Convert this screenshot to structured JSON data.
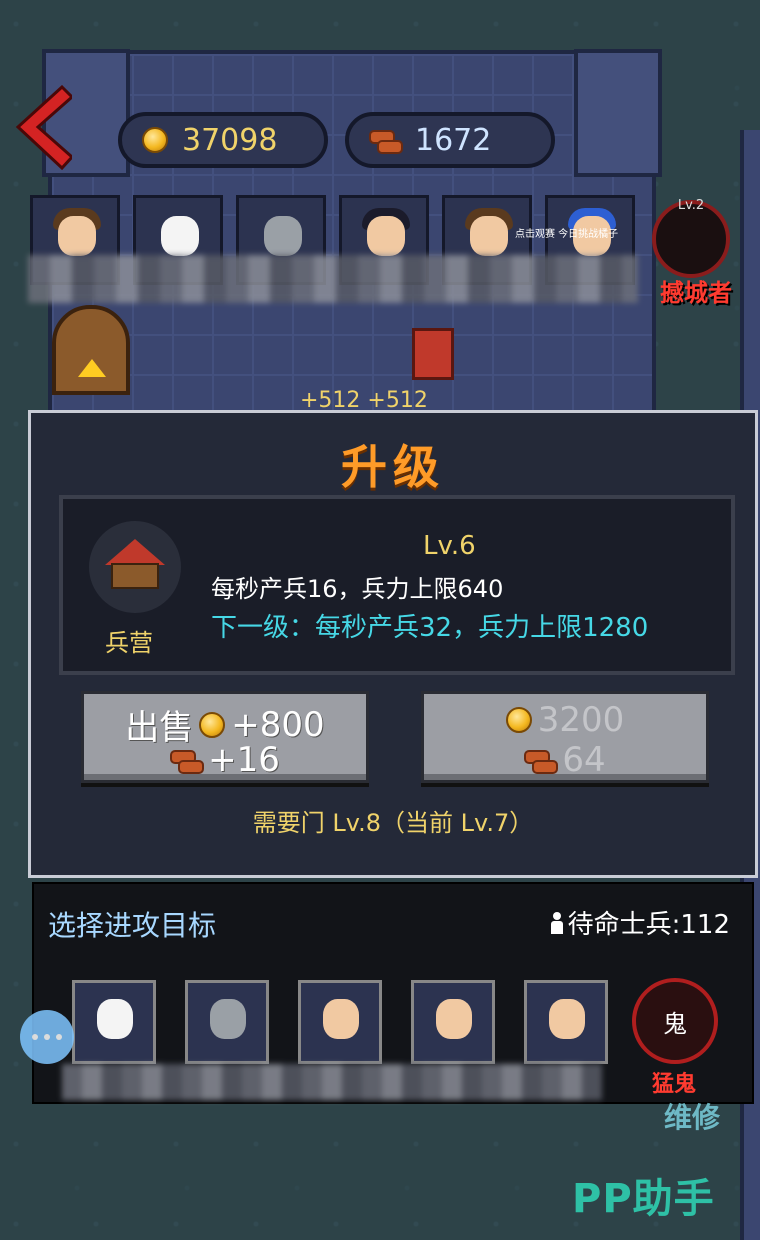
{
  "resources": {
    "gold": "37098",
    "wood": "1672"
  },
  "top_avatars": [
    "avatar-1",
    "avatar-2",
    "avatar-3",
    "avatar-4",
    "avatar-5",
    "avatar-6"
  ],
  "avatar_small_text": "点击观赛 今日挑战橘子",
  "enemy": {
    "level": "Lv.2",
    "name": "撼城者"
  },
  "production_gain": "+512 +512",
  "upgrade_panel": {
    "title": "升级",
    "building_name": "兵营",
    "level": "Lv.6",
    "current_stats": "每秒产兵16，兵力上限640",
    "next_stats": "下一级：每秒产兵32，兵力上限1280",
    "sell_label": "出售",
    "sell_gold": "+800",
    "sell_wood": "+16",
    "upgrade_gold": "3200",
    "upgrade_wood": "64",
    "requirement": "需要门 Lv.8（当前 Lv.7）"
  },
  "attack": {
    "title": "选择进攻目标",
    "standby_soldiers": "待命士兵:112",
    "ghost_icon_label": "鬼",
    "ghost_name": "猛鬼"
  },
  "repair_label": "维修",
  "watermark": "PP助手",
  "colors": {
    "accent_orange": "#ff9b28",
    "gold_text": "#f0d36a",
    "cyan_text": "#46d8e6",
    "enemy_red": "#ff3b30"
  }
}
